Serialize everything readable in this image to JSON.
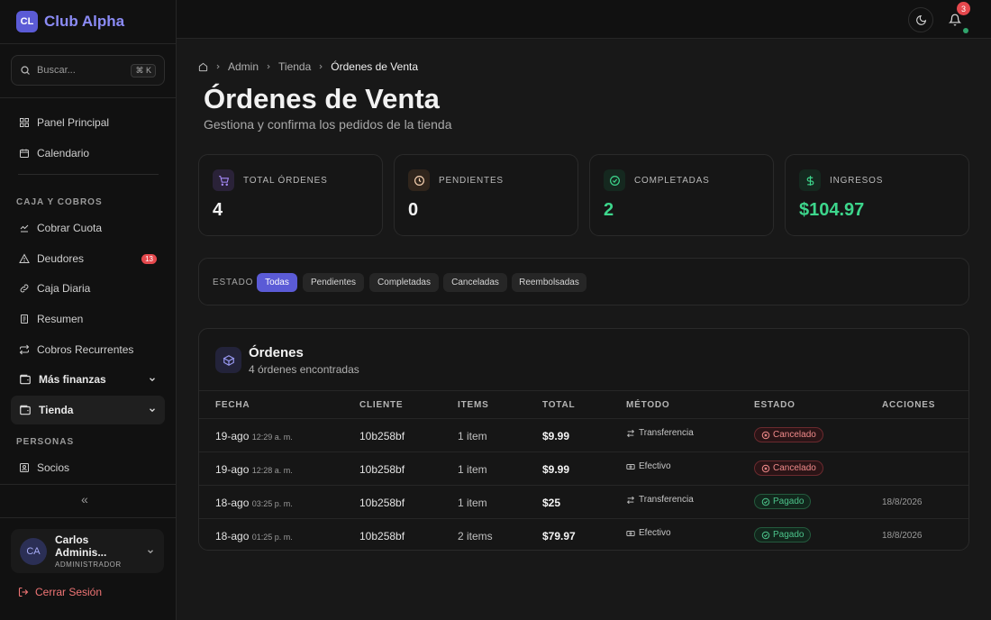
{
  "brand": {
    "logo": "CL",
    "name": "Club Alpha"
  },
  "search": {
    "placeholder": "Buscar...",
    "shortcut": "⌘ K"
  },
  "nav": {
    "panel": "Panel Principal",
    "calendar": "Calendario",
    "section_caja": "CAJA Y COBROS",
    "cobrar": "Cobrar Cuota",
    "deudores": "Deudores",
    "deudores_count": "13",
    "caja_diaria": "Caja Diaria",
    "resumen": "Resumen",
    "recurrentes": "Cobros Recurrentes",
    "mas_finanzas": "Más finanzas",
    "tienda": "Tienda",
    "section_personas": "PERSONAS",
    "socios": "Socios",
    "collapse": "«"
  },
  "user": {
    "initials": "CA",
    "name": "Carlos Adminis...",
    "role": "ADMINISTRADOR"
  },
  "logout": "Cerrar Sesión",
  "header": {
    "notifications": "3"
  },
  "breadcrumb": {
    "admin": "Admin",
    "tienda": "Tienda",
    "current": "Órdenes de Venta"
  },
  "page": {
    "title": "Órdenes de Venta",
    "subtitle": "Gestiona y confirma los pedidos de la tienda"
  },
  "stats": [
    {
      "label": "TOTAL ÓRDENES",
      "value": "4"
    },
    {
      "label": "PENDIENTES",
      "value": "0"
    },
    {
      "label": "COMPLETADAS",
      "value": "2"
    },
    {
      "label": "INGRESOS",
      "value": "$104.97"
    }
  ],
  "filters": {
    "label": "ESTADO",
    "options": [
      "Todas",
      "Pendientes",
      "Completadas",
      "Canceladas",
      "Reembolsadas"
    ]
  },
  "orders": {
    "title": "Órdenes",
    "count": "4 órdenes encontradas",
    "columns": [
      "FECHA",
      "CLIENTE",
      "ITEMS",
      "TOTAL",
      "MÉTODO",
      "ESTADO",
      "ACCIONES"
    ],
    "rows": [
      {
        "date": "19-ago",
        "time": "12:29 a. m.",
        "client": "10b258bf",
        "items": "1 item",
        "total": "$9.99",
        "method": "Transferencia",
        "status": "Cancelado",
        "action": ""
      },
      {
        "date": "19-ago",
        "time": "12:28 a. m.",
        "client": "10b258bf",
        "items": "1 item",
        "total": "$9.99",
        "method": "Efectivo",
        "status": "Cancelado",
        "action": ""
      },
      {
        "date": "18-ago",
        "time": "03:25 p. m.",
        "client": "10b258bf",
        "items": "1 item",
        "total": "$25",
        "method": "Transferencia",
        "status": "Pagado",
        "action": "18/8/2026"
      },
      {
        "date": "18-ago",
        "time": "01:25 p. m.",
        "client": "10b258bf",
        "items": "2 items",
        "total": "$79.97",
        "method": "Efectivo",
        "status": "Pagado",
        "action": "18/8/2026"
      }
    ]
  },
  "colors": {
    "accent": "#5b5bd6",
    "success": "#3dd68c",
    "danger": "#e5484d"
  }
}
